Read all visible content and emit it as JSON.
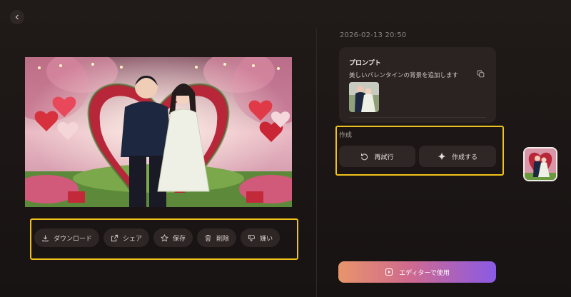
{
  "timestamp": "2026-02-13 20:50",
  "actions": {
    "download": "ダウンロード",
    "share": "シェア",
    "save": "保存",
    "delete": "削除",
    "dislike": "嫌い"
  },
  "prompt": {
    "title": "プロンプト",
    "text": "美しいバレンタインの背景を追加します"
  },
  "create": {
    "label": "作成",
    "retry": "再試行",
    "generate": "作成する"
  },
  "editor_button": "エディターで使用",
  "colors": {
    "highlight": "#f1c21b",
    "editor_gradient_start": "#e8956b",
    "editor_gradient_end": "#8a5ae6"
  },
  "icons": [
    "chevron-left-icon",
    "download-icon",
    "share-icon",
    "star-icon",
    "trash-icon",
    "thumbs-down-icon",
    "copy-icon",
    "retry-icon",
    "sparkle-icon",
    "editor-icon"
  ]
}
